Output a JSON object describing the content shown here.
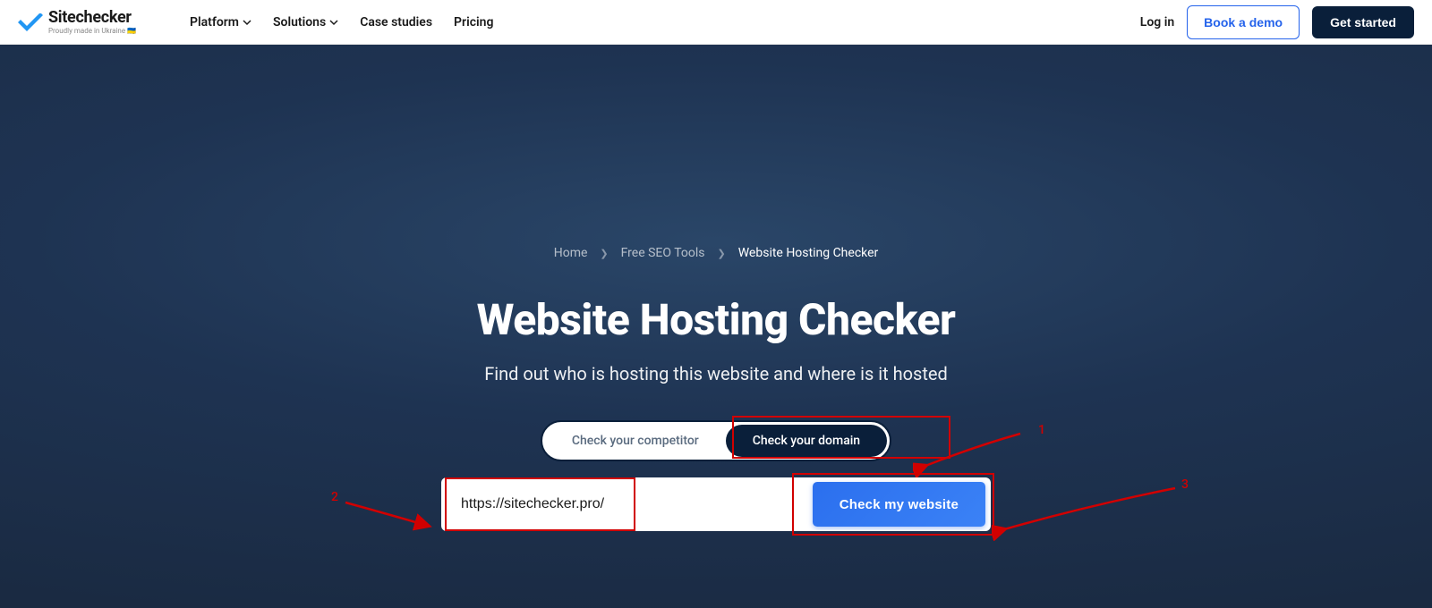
{
  "header": {
    "logo_name": "Sitechecker",
    "logo_tagline": "Proudly made in Ukraine 🇺🇦",
    "nav": {
      "platform": "Platform",
      "solutions": "Solutions",
      "case_studies": "Case studies",
      "pricing": "Pricing"
    },
    "login": "Log in",
    "book_demo": "Book a demo",
    "get_started": "Get started"
  },
  "breadcrumb": {
    "home": "Home",
    "tools": "Free SEO Tools",
    "current": "Website Hosting Checker"
  },
  "hero": {
    "title": "Website Hosting Checker",
    "subtitle": "Find out who is hosting this website and where is it hosted",
    "toggle_competitor": "Check your competitor",
    "toggle_domain": "Check your domain",
    "url_value": "https://sitechecker.pro/",
    "check_button": "Check my website"
  },
  "annotations": {
    "one": "1",
    "two": "2",
    "three": "3"
  }
}
